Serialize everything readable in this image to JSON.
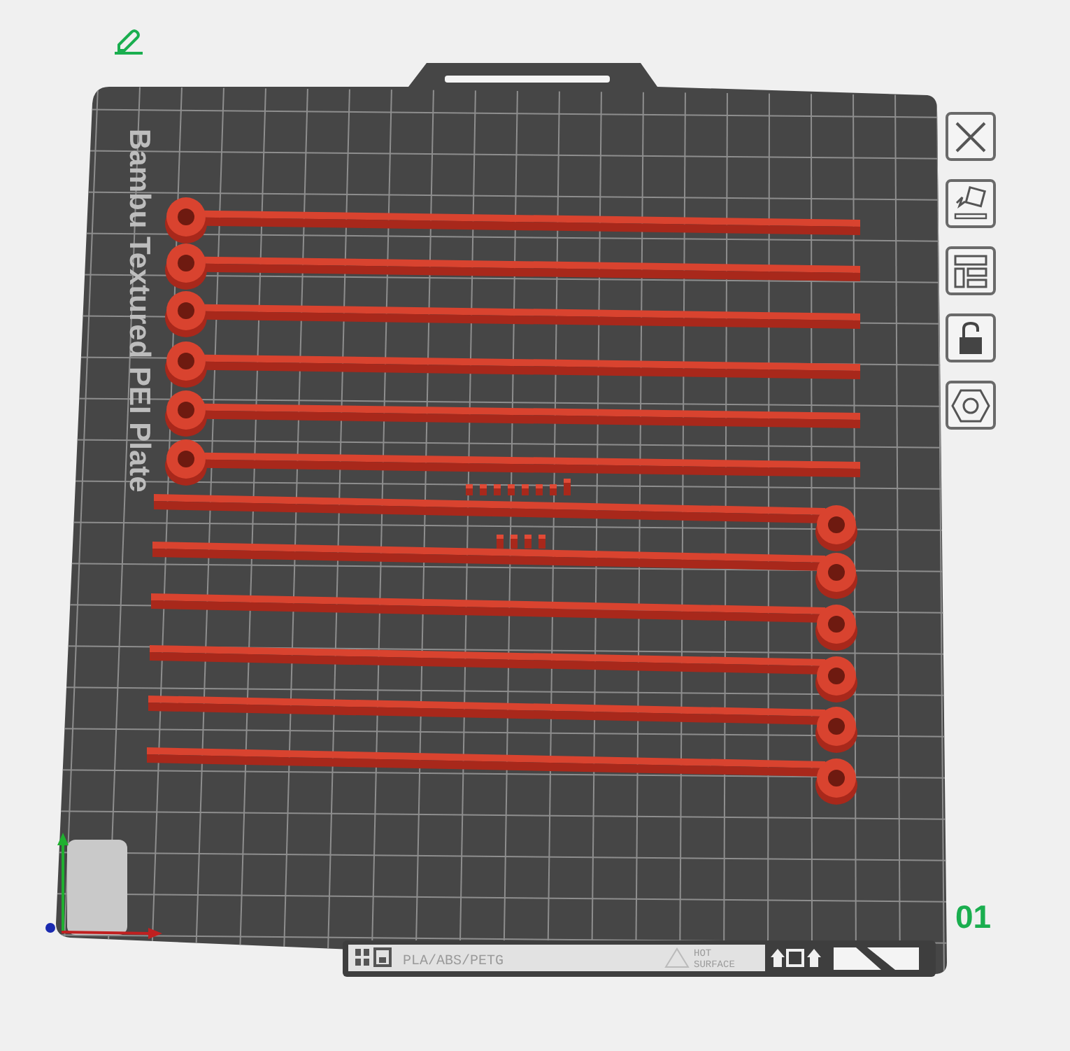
{
  "plate": {
    "name": "Bambu Textured PEI Plate",
    "number": "01"
  },
  "label_strip": {
    "materials": "PLA/ABS/PETG",
    "warning": [
      "HOT",
      "SURFACE"
    ]
  }
}
